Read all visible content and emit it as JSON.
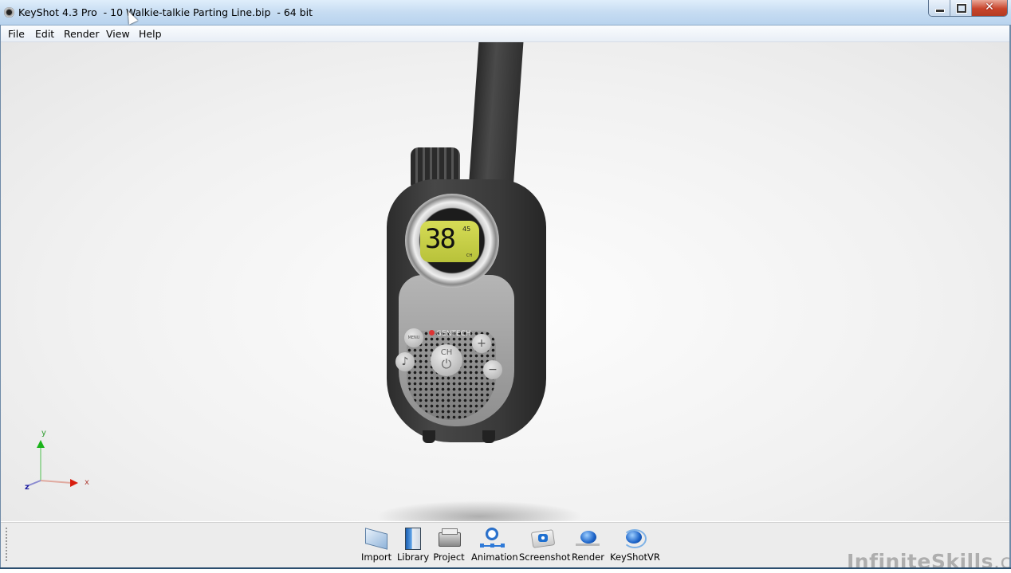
{
  "window": {
    "title": "KeyShot 4.3 Pro  - 10 Walkie-talkie Parting Line.bip  - 64 bit",
    "controls": {
      "minimize": "minimize",
      "maximize": "maximize",
      "close": "✕"
    }
  },
  "menu": {
    "items": [
      {
        "label": "File"
      },
      {
        "label": "Edit"
      },
      {
        "label": "Render"
      },
      {
        "label": "View"
      },
      {
        "label": "Help"
      }
    ]
  },
  "viewport": {
    "model": {
      "lcd_channel": "38",
      "lcd_small": "45",
      "lcd_unit": "CH",
      "brand": "GENTECH",
      "button_menu": "MENU",
      "button_ch": "CH",
      "button_plus": "+",
      "button_minus": "−"
    },
    "axis": {
      "x": "x",
      "y": "y",
      "z": "z"
    }
  },
  "toolbar": {
    "items": [
      {
        "label": "Import",
        "icon": "import-icon"
      },
      {
        "label": "Library",
        "icon": "library-icon"
      },
      {
        "label": "Project",
        "icon": "project-icon"
      },
      {
        "label": "Animation",
        "icon": "animation-icon"
      },
      {
        "label": "Screenshot",
        "icon": "screenshot-icon"
      },
      {
        "label": "Render",
        "icon": "render-teapot-icon"
      },
      {
        "label": "KeyShotVR",
        "icon": "keyshotvr-icon"
      }
    ]
  },
  "watermark": {
    "name": "InfiniteSkills",
    "suffix": ".com"
  }
}
